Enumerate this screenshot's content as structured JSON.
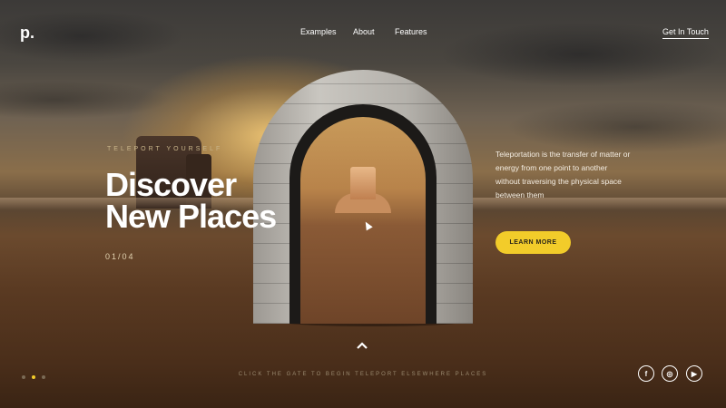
{
  "brand": {
    "logo": "p."
  },
  "nav": {
    "examples": "Examples",
    "about": "About",
    "features": "Features",
    "contact": "Get In Touch"
  },
  "hero": {
    "eyebrow": "TELEPORT YOURSELF",
    "title_line1": "Discover",
    "title_line2": "New Places",
    "counter": "01/04",
    "description": "Teleportation is the transfer of matter or energy from one point to another without traversing the physical space between them",
    "cta": "LEARN MORE"
  },
  "footer": {
    "hint": "CLICK THE GATE TO BEGIN TELEPORT ELSEWHERE PLACES",
    "social": {
      "facebook": "f",
      "instagram": "◎",
      "youtube": "▶"
    }
  },
  "slider": {
    "total_dots": 3,
    "active_index": 1
  },
  "colors": {
    "accent": "#f2cc2a",
    "text": "#ffffff",
    "stone": "#b8b5ae"
  },
  "icons": [
    "up-chevron-icon",
    "facebook-icon",
    "instagram-icon",
    "youtube-icon",
    "cursor-icon"
  ]
}
